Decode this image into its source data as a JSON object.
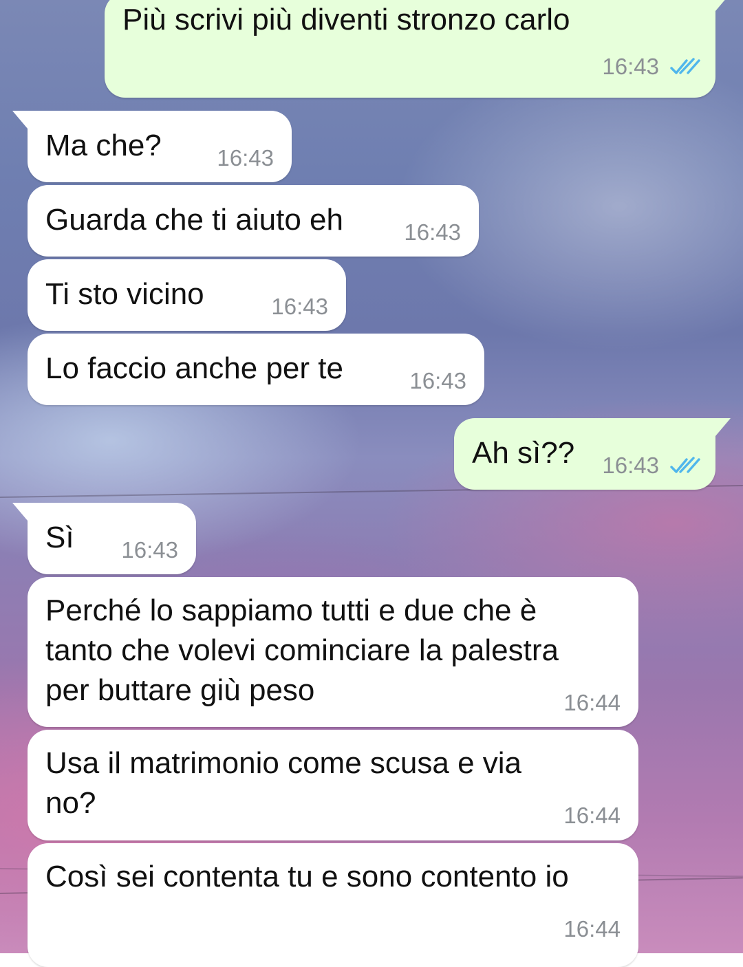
{
  "colors": {
    "incoming_bubble": "#ffffff",
    "outgoing_bubble": "#e7ffdb",
    "text": "#111111",
    "timestamp": "#8b8f94",
    "read_ticks": "#4fb6ec"
  },
  "messages": [
    {
      "direction": "outgoing",
      "text": "Più scrivi più diventi stronzo carlo",
      "time": "16:43",
      "status_icon": "double-check-read-icon"
    },
    {
      "direction": "incoming",
      "text": "Ma che?",
      "time": "16:43"
    },
    {
      "direction": "incoming",
      "text": "Guarda che ti aiuto eh",
      "time": "16:43"
    },
    {
      "direction": "incoming",
      "text": "Ti sto vicino",
      "time": "16:43"
    },
    {
      "direction": "incoming",
      "text": "Lo faccio anche per te",
      "time": "16:43"
    },
    {
      "direction": "outgoing",
      "text": "Ah sì??",
      "time": "16:43",
      "status_icon": "double-check-read-icon"
    },
    {
      "direction": "incoming",
      "text": "Sì",
      "time": "16:43"
    },
    {
      "direction": "incoming",
      "text": "Perché lo sappiamo tutti e due che è\ntanto che volevi cominciare la palestra\nper buttare giù peso",
      "time": "16:44"
    },
    {
      "direction": "incoming",
      "text": "Usa il matrimonio come scusa e via\nno?",
      "time": "16:44"
    },
    {
      "direction": "incoming",
      "text": "Così sei contenta tu e sono contento io",
      "time": "16:44"
    }
  ]
}
